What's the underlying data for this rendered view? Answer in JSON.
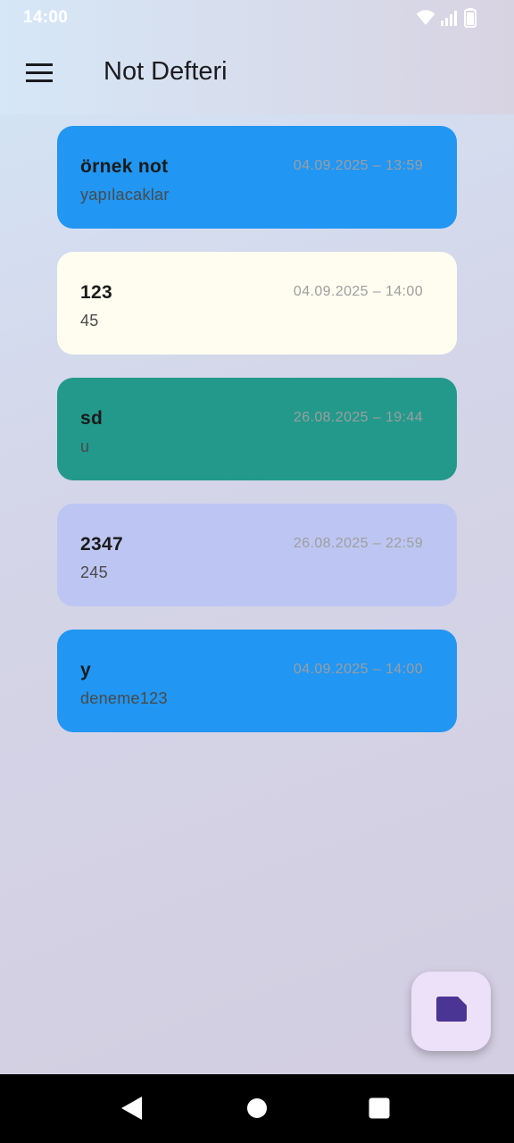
{
  "status_bar": {
    "time": "14:00",
    "icons": [
      "wifi-icon",
      "signal-icon",
      "battery-icon"
    ]
  },
  "app_bar": {
    "menu_icon": "menu-icon",
    "title": "Not Defteri"
  },
  "notes": [
    {
      "title": "örnek not",
      "date": "04.09.2025 – 13:59",
      "body": "yapılacaklar",
      "color": "#2196f3"
    },
    {
      "title": "123",
      "date": "04.09.2025 – 14:00",
      "body": "45",
      "color": "#fefdf0"
    },
    {
      "title": "sd",
      "date": "26.08.2025 – 19:44",
      "body": "u",
      "color": "#22998b"
    },
    {
      "title": "2347",
      "date": "26.08.2025 – 22:59",
      "body": "245",
      "color": "#bdc6f2"
    },
    {
      "title": "y",
      "date": "04.09.2025 – 14:00",
      "body": "deneme123",
      "color": "#2196f3"
    }
  ],
  "fab": {
    "icon": "new-note-icon",
    "background": "#ede0f9",
    "icon_color": "#4a3494"
  },
  "nav_bar": {
    "buttons": [
      "back-icon",
      "home-icon",
      "recents-icon"
    ]
  }
}
